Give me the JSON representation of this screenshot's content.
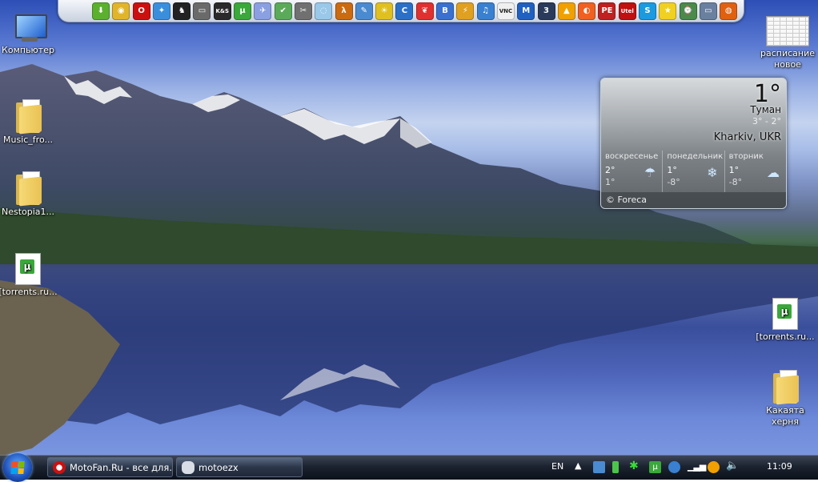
{
  "dock": {
    "icons": [
      {
        "name": "download-icon",
        "color": "#5bb02d",
        "glyph": "⬇"
      },
      {
        "name": "chrome-icon",
        "color": "#e0b52a",
        "glyph": "◉"
      },
      {
        "name": "opera-icon",
        "color": "#cc1010",
        "glyph": "O"
      },
      {
        "name": "safari-icon",
        "color": "#3a8fdc",
        "glyph": "✦"
      },
      {
        "name": "tux-icon",
        "color": "#222222",
        "glyph": "♞"
      },
      {
        "name": "window-icon",
        "color": "#6a6a6a",
        "glyph": "▭"
      },
      {
        "name": "ks-icon",
        "color": "#2a2a2a",
        "glyph": "K&S"
      },
      {
        "name": "utorrent-icon",
        "color": "#3aa83a",
        "glyph": "µ"
      },
      {
        "name": "plane-icon",
        "color": "#8aa0e0",
        "glyph": "✈"
      },
      {
        "name": "checklist-icon",
        "color": "#5aaa5a",
        "glyph": "✔"
      },
      {
        "name": "scissors-icon",
        "color": "#707070",
        "glyph": "✂"
      },
      {
        "name": "globe-icon",
        "color": "#9ac8e8",
        "glyph": "◌"
      },
      {
        "name": "halflife-icon",
        "color": "#cc6a10",
        "glyph": "λ"
      },
      {
        "name": "pen-icon",
        "color": "#4a8ad0",
        "glyph": "✎"
      },
      {
        "name": "sun-icon",
        "color": "#e0c020",
        "glyph": "☀"
      },
      {
        "name": "ccleaner-icon",
        "color": "#2a70c8",
        "glyph": "C"
      },
      {
        "name": "bird-icon",
        "color": "#e03030",
        "glyph": "❦"
      },
      {
        "name": "disk-icon",
        "color": "#3a70d0",
        "glyph": "B"
      },
      {
        "name": "winamp-icon",
        "color": "#e0a020",
        "glyph": "⚡"
      },
      {
        "name": "music-icon",
        "color": "#3a80d0",
        "glyph": "♫"
      },
      {
        "name": "vnc-icon",
        "color": "#f0f0f0",
        "glyph": "VNC"
      },
      {
        "name": "maxthon-icon",
        "color": "#2060c0",
        "glyph": "M"
      },
      {
        "name": "three-icon",
        "color": "#2a3a5a",
        "glyph": "3"
      },
      {
        "name": "avast-icon",
        "color": "#f0a000",
        "glyph": "▲"
      },
      {
        "name": "orange-icon",
        "color": "#f06020",
        "glyph": "◐"
      },
      {
        "name": "pe-icon",
        "color": "#c02020",
        "glyph": "PE"
      },
      {
        "name": "utel-icon",
        "color": "#c01010",
        "glyph": "Utel"
      },
      {
        "name": "skype-icon",
        "color": "#1a9ae0",
        "glyph": "S"
      },
      {
        "name": "star-icon",
        "color": "#f0d020",
        "glyph": "★"
      },
      {
        "name": "alarm-icon",
        "color": "#4a8a4a",
        "glyph": "⌚"
      },
      {
        "name": "laptop-icon",
        "color": "#6a80a0",
        "glyph": "▭"
      },
      {
        "name": "firefox-icon",
        "color": "#e06010",
        "glyph": "◍"
      }
    ]
  },
  "desktop_icons": {
    "computer": "Компьютер",
    "music_folder": "Music_fro...",
    "nestopia_folder": "Nestopia1...",
    "torrent_left": "[torrents.ru...",
    "schedule": "расписание новое",
    "torrent_right": "[torrents.ru...",
    "kakayato_folder": "Какаята херня"
  },
  "weather": {
    "temp": "1°",
    "condition": "Туман",
    "range": "3° - 2°",
    "location": "Kharkiv, UKR",
    "forecast": [
      {
        "day": "воскресенье",
        "hi": "2°",
        "lo": "1°",
        "icon": "rain-icon",
        "glyph": "☂"
      },
      {
        "day": "понедельник",
        "hi": "1°",
        "lo": "-8°",
        "icon": "snow-icon",
        "glyph": "❄"
      },
      {
        "day": "вторник",
        "hi": "1°",
        "lo": "-8°",
        "icon": "cloud-icon",
        "glyph": "☁"
      }
    ],
    "credit": "© Foreca"
  },
  "taskbar": {
    "tasks": [
      {
        "label": "MotoFan.Ru - все для...",
        "icon": "opera-icon",
        "color": "#cc1010"
      },
      {
        "label": "motoezx",
        "icon": "chat-icon",
        "color": "#d8dde6"
      }
    ],
    "language": "EN",
    "clock": "11:09"
  }
}
